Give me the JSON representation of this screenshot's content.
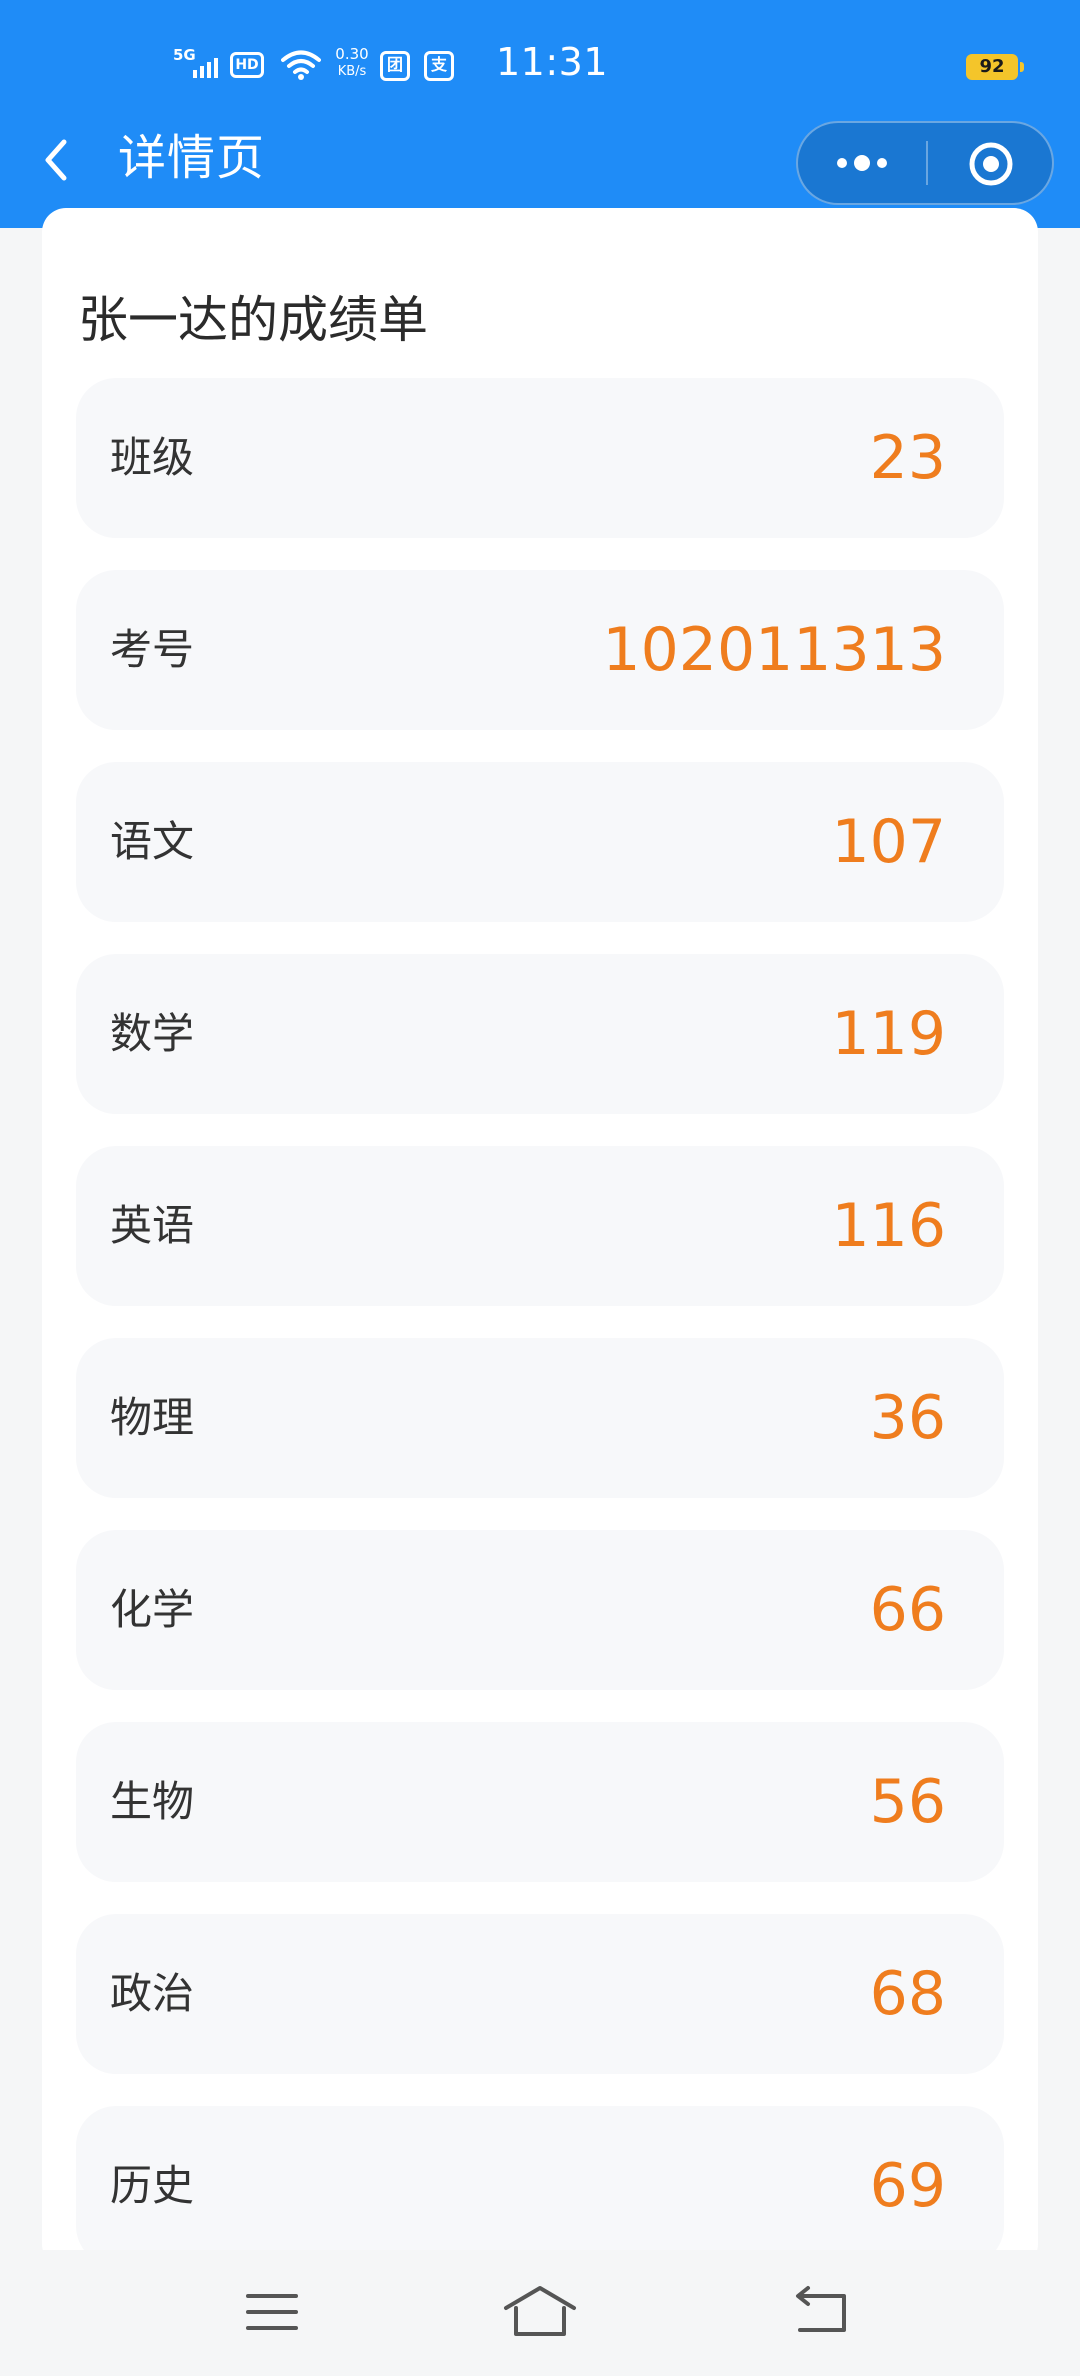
{
  "status_bar": {
    "network": "5G",
    "hd_badge": "HD",
    "speed_value": "0.30",
    "speed_unit": "KB/s",
    "app_icon_1": "团",
    "app_icon_2": "支",
    "time": "11:31",
    "battery": "92"
  },
  "nav": {
    "title": "详情页",
    "back_icon": "chevron-left-icon",
    "more_icon": "more-dots-icon",
    "close_icon": "target-close-icon"
  },
  "card": {
    "title": "张一达的成绩单",
    "rows": [
      {
        "label": "班级",
        "value": "23"
      },
      {
        "label": "考号",
        "value": "102011313"
      },
      {
        "label": "语文",
        "value": "107"
      },
      {
        "label": "数学",
        "value": "119"
      },
      {
        "label": "英语",
        "value": "116"
      },
      {
        "label": "物理",
        "value": "36"
      },
      {
        "label": "化学",
        "value": "66"
      },
      {
        "label": "生物",
        "value": "56"
      },
      {
        "label": "政治",
        "value": "68"
      },
      {
        "label": "历史",
        "value": "69"
      }
    ]
  },
  "bottom_nav": {
    "menu_icon": "menu-icon",
    "home_icon": "home-icon",
    "back_icon": "back-icon"
  },
  "colors": {
    "header_blue": "#1f8cf7",
    "value_orange": "#ef7d1e",
    "row_bg": "#f7f8fa"
  }
}
